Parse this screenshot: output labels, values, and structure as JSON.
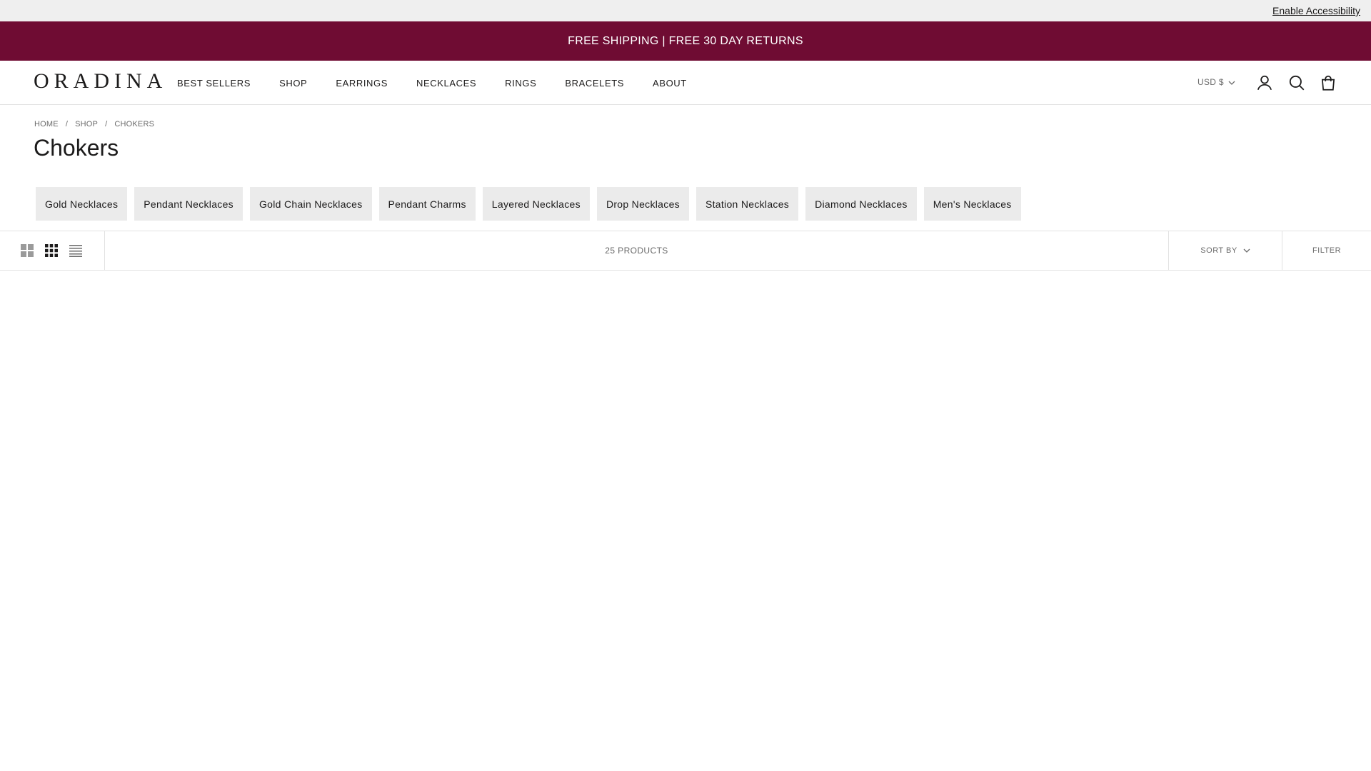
{
  "accessibility_bar": {
    "link_label": "Enable Accessibility"
  },
  "promo_bar": {
    "text": "FREE SHIPPING | FREE 30 DAY RETURNS",
    "background": "#6f0c33"
  },
  "header": {
    "logo_text": "ORADINA",
    "nav": [
      "BEST SELLERS",
      "SHOP",
      "EARRINGS",
      "NECKLACES",
      "RINGS",
      "BRACELETS",
      "ABOUT"
    ],
    "currency_label": "USD $",
    "icons": [
      "account-icon",
      "search-icon",
      "cart-icon"
    ]
  },
  "breadcrumb": [
    "HOME",
    "SHOP",
    "CHOKERS"
  ],
  "breadcrumb_separator": "/",
  "page_title": "Chokers",
  "category_chips": [
    "Gold Necklaces",
    "Pendant Necklaces",
    "Gold Chain Necklaces",
    "Pendant Charms",
    "Layered Necklaces",
    "Drop Necklaces",
    "Station Necklaces",
    "Diamond Necklaces",
    "Men's Necklaces"
  ],
  "toolbar": {
    "layout_options": [
      "grid-2-icon",
      "grid-3-icon",
      "list-icon"
    ],
    "product_count": "25 PRODUCTS",
    "sort_label": "SORT BY",
    "filter_label": "FILTER"
  }
}
